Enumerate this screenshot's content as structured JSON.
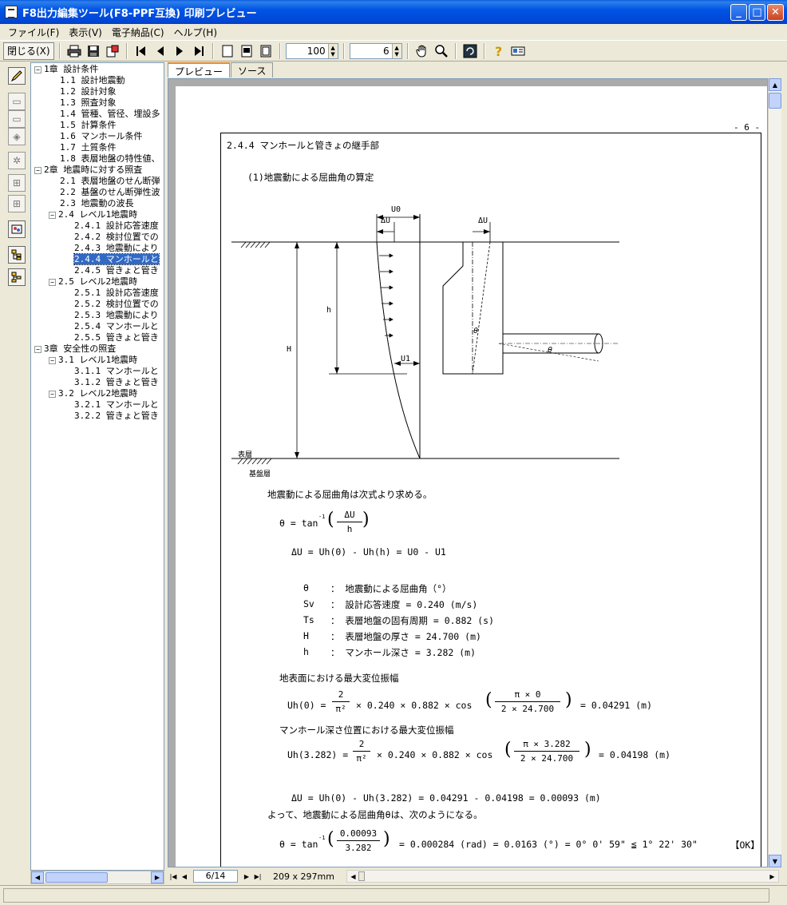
{
  "window": {
    "title": "F8出力編集ツール(F8-PPF互換) 印刷プレビュー",
    "min": "_",
    "max": "□",
    "close": "✕"
  },
  "menu": [
    "ファイル(F)",
    "表示(V)",
    "電子納品(C)",
    "ヘルプ(H)"
  ],
  "toolbar": {
    "close_label": "閉じる(X)",
    "zoom_value": "100",
    "page_spin_value": "6"
  },
  "tree": [
    {
      "label": "1章 設計条件",
      "level": 0,
      "exp": "−"
    },
    {
      "label": "1.1 設計地震動",
      "level": 1
    },
    {
      "label": "1.2 設計対象",
      "level": 1
    },
    {
      "label": "1.3 照査対象",
      "level": 1
    },
    {
      "label": "1.4 管種、管径、埋設多",
      "level": 1
    },
    {
      "label": "1.5 計算条件",
      "level": 1
    },
    {
      "label": "1.6 マンホール条件",
      "level": 1
    },
    {
      "label": "1.7 土質条件",
      "level": 1
    },
    {
      "label": "1.8 表層地盤の特性値、",
      "level": 1
    },
    {
      "label": "2章 地震時に対する照査",
      "level": 0,
      "exp": "−"
    },
    {
      "label": "2.1 表層地盤のせん断弾",
      "level": 1
    },
    {
      "label": "2.2 基盤のせん断弾性波",
      "level": 1
    },
    {
      "label": "2.3 地震動の波長",
      "level": 1
    },
    {
      "label": "2.4 レベル1地震時",
      "level": 1,
      "exp": "−"
    },
    {
      "label": "2.4.1 設計応答速度",
      "level": 2
    },
    {
      "label": "2.4.2 検討位置での",
      "level": 2
    },
    {
      "label": "2.4.3 地震動により",
      "level": 2
    },
    {
      "label": "2.4.4 マンホールと",
      "level": 2,
      "selected": true
    },
    {
      "label": "2.4.5 管きょと管き",
      "level": 2
    },
    {
      "label": "2.5 レベル2地震時",
      "level": 1,
      "exp": "−"
    },
    {
      "label": "2.5.1 設計応答速度",
      "level": 2
    },
    {
      "label": "2.5.2 検討位置での",
      "level": 2
    },
    {
      "label": "2.5.3 地震動により",
      "level": 2
    },
    {
      "label": "2.5.4 マンホールと",
      "level": 2
    },
    {
      "label": "2.5.5 管きょと管き",
      "level": 2
    },
    {
      "label": "3章 安全性の照査",
      "level": 0,
      "exp": "−"
    },
    {
      "label": "3.1 レベル1地震時",
      "level": 1,
      "exp": "−"
    },
    {
      "label": "3.1.1 マンホールと",
      "level": 2
    },
    {
      "label": "3.1.2 管きょと管き",
      "level": 2
    },
    {
      "label": "3.2 レベル2地震時",
      "level": 1,
      "exp": "−"
    },
    {
      "label": "3.2.1 マンホールと",
      "level": 2
    },
    {
      "label": "3.2.2 管きょと管き",
      "level": 2
    }
  ],
  "tabs": {
    "preview": "プレビュー",
    "source": "ソース"
  },
  "nav": {
    "page": "6/14",
    "paper_size": "209 x 297mm"
  },
  "doc": {
    "page_no": "- 6 -",
    "section": "2.4.4 マンホールと管きょの継手部",
    "sub": "(1)地震動による屈曲角の算定",
    "fig": {
      "U0": "U0",
      "dU1": "ΔU",
      "dU2": "ΔU",
      "h": "h",
      "H": "H",
      "U1": "U1",
      "theta1": "θ",
      "theta2": "θ",
      "surface": "表層",
      "base": "基盤層"
    },
    "intro": "地震動による屈曲角は次式より求める。",
    "eq1_lhs": "θ = tan",
    "eq1_sup": "-1",
    "eq1_num": "ΔU",
    "eq1_den": "h",
    "eq2": "ΔU  = Uh(0) - Uh(h) = U0 - U1",
    "defs": [
      {
        "sym": "θ",
        "desc": "： 地震動による屈曲角（°）"
      },
      {
        "sym": "Sv",
        "desc": "： 設計応答速度 = 0.240 (m/s)"
      },
      {
        "sym": "Ts",
        "desc": "： 表層地盤の固有周期 = 0.882 (s)"
      },
      {
        "sym": "H",
        "desc": "： 表層地盤の厚さ = 24.700 (m)"
      },
      {
        "sym": "h",
        "desc": "： マンホール深さ = 3.282 (m)"
      }
    ],
    "head_surface": "地表面における最大変位振幅",
    "uh0_lhs": "Uh(0) =",
    "two": "2",
    "pi2": "π²",
    "uh_mid": "× 0.240 × 0.882 × cos",
    "uh0_num": "π × 0",
    "uh_den": "2 × 24.700",
    "uh0_res": "= 0.04291 (m)",
    "head_depth": "マンホール深さ位置における最大変位振幅",
    "uhh_lhs": "Uh(3.282) =",
    "uhh_num": "π × 3.282",
    "uhh_res": "= 0.04198 (m)",
    "du_calc": "ΔU = Uh(0) - Uh(3.282) = 0.04291 - 0.04198 = 0.00093 (m)",
    "conclusion": "よって、地震動による屈曲角θは、次のようになる。",
    "fin_lhs": "θ = tan",
    "fin_num": "0.00093",
    "fin_den": "3.282",
    "fin_res": "= 0.000284 (rad) = 0.0163 (°) = 0° 0' 59\"   ≦ 1° 22' 30\"",
    "ok": "【OK】"
  }
}
